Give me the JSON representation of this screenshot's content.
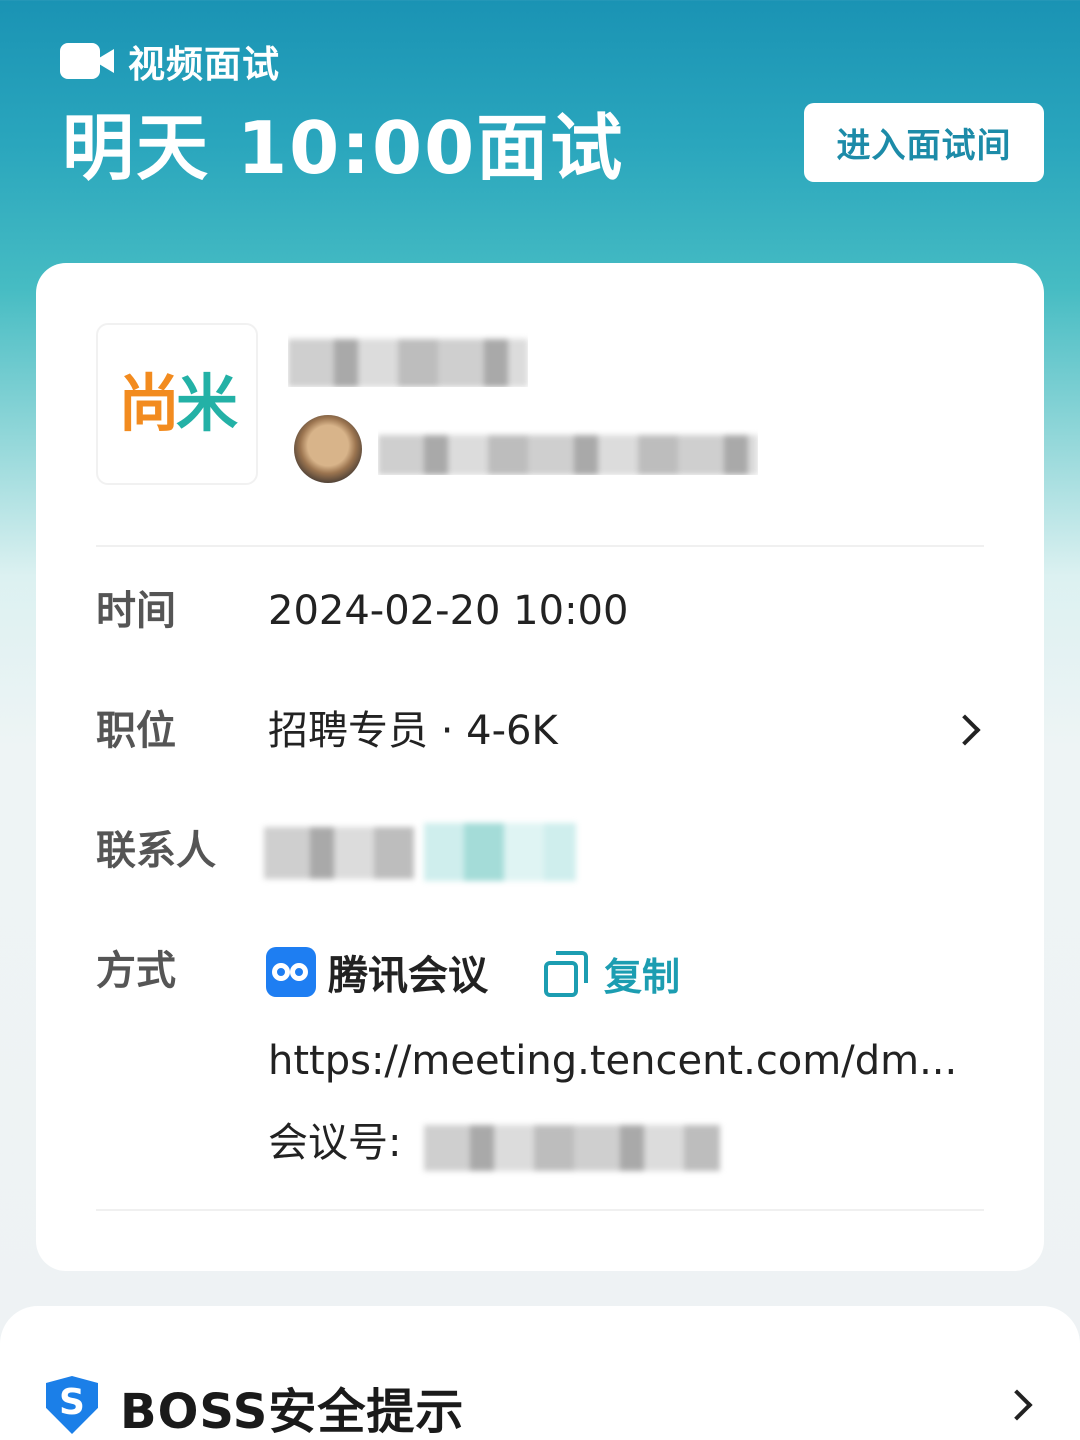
{
  "header": {
    "interview_type": "视频面试",
    "title": "明天 10:00面试",
    "enter_button": "进入面试间"
  },
  "company": {
    "logo_text_left": "尚",
    "logo_text_right": "米",
    "logo_colors": {
      "left": "#f28b1f",
      "right": "#23b1a6"
    }
  },
  "details": {
    "time_label": "时间",
    "time_value": "2024-02-20 10:00",
    "position_label": "职位",
    "position_value": "招聘专员 · 4-6K",
    "contact_label": "联系人",
    "method_label": "方式",
    "meeting_app": "腾讯会议",
    "copy_label": "复制",
    "meeting_url": "https://meeting.tencent.com/dm...",
    "meeting_id_label": "会议号:"
  },
  "safety": {
    "title": "BOSS安全提示",
    "shield_letter": "S",
    "shield_color": "#1b7fe8"
  },
  "icons": [
    "video-camera-icon",
    "tencent-meeting-icon",
    "copy-icon",
    "chevron-right-icon",
    "shield-icon"
  ],
  "colors": {
    "accent": "#1c9db1",
    "header_top": "#1a93b4"
  }
}
